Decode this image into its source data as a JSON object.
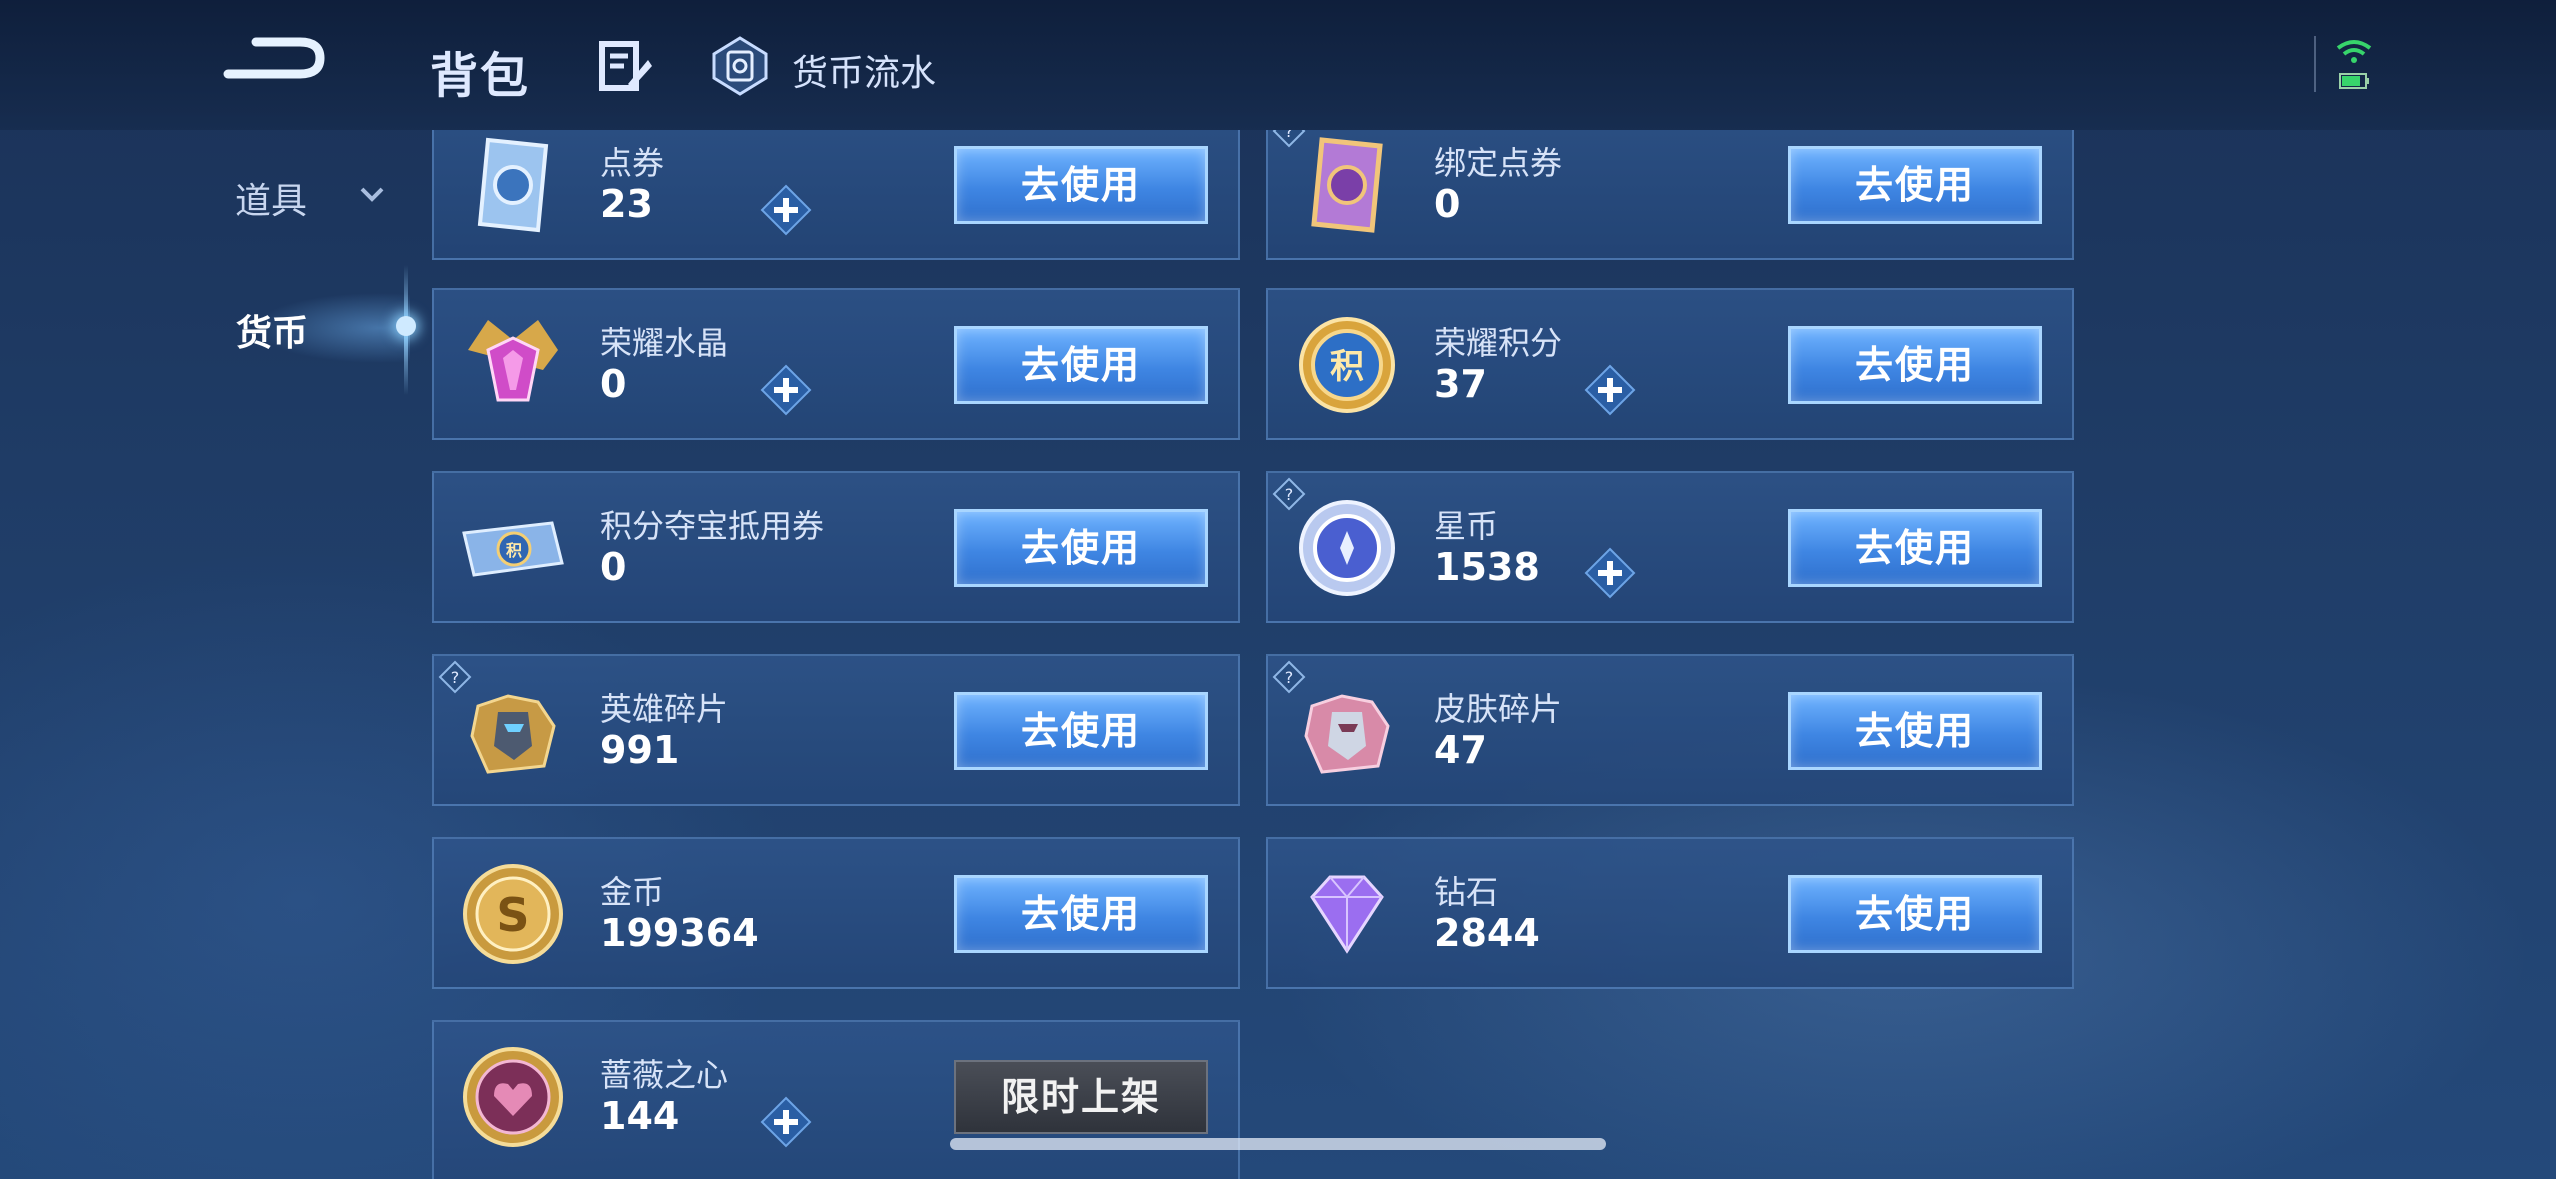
{
  "header": {
    "title": "背包",
    "flow_label": "货币流水"
  },
  "sidebar": {
    "items": [
      {
        "label": "道具"
      },
      {
        "label": "货币"
      }
    ]
  },
  "currencies": [
    {
      "name": "点券",
      "count": "23",
      "button": "去使用"
    },
    {
      "name": "绑定点券",
      "count": "0",
      "button": "去使用"
    },
    {
      "name": "荣耀水晶",
      "count": "0",
      "button": "去使用"
    },
    {
      "name": "荣耀积分",
      "count": "37",
      "button": "去使用"
    },
    {
      "name": "积分夺宝抵用券",
      "count": "0",
      "button": "去使用"
    },
    {
      "name": "星币",
      "count": "1538",
      "button": "去使用"
    },
    {
      "name": "英雄碎片",
      "count": "991",
      "button": "去使用"
    },
    {
      "name": "皮肤碎片",
      "count": "47",
      "button": "去使用"
    },
    {
      "name": "金币",
      "count": "199364",
      "button": "去使用"
    },
    {
      "name": "钻石",
      "count": "2844",
      "button": "去使用"
    },
    {
      "name": "蔷薇之心",
      "count": "144",
      "button": "限时上架"
    }
  ],
  "icons": {
    "coupon": "ticket-icon",
    "bound_coupon": "bound-ticket-icon",
    "crystal": "glory-crystal-icon",
    "points": "glory-points-icon",
    "voucher": "points-voucher-icon",
    "star_coin": "star-coin-icon",
    "hero_shard": "hero-shard-icon",
    "skin_shard": "skin-shard-icon",
    "gold": "gold-coin-icon",
    "diamond": "diamond-icon",
    "rose": "rose-heart-icon"
  },
  "colors": {
    "use_button": "#3f86e3",
    "limited_button": "#3a3e46",
    "background": "#1f3c66"
  }
}
